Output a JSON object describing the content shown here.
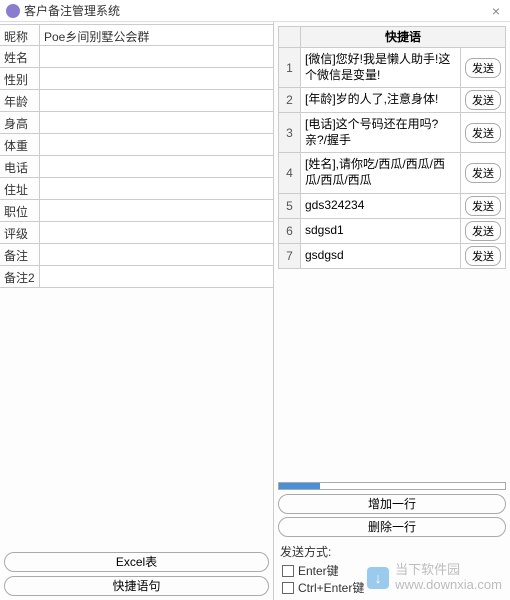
{
  "window": {
    "title": "客户备注管理系统",
    "close": "×"
  },
  "form": {
    "fields": [
      {
        "label": "昵称",
        "value": "Poe乡间别墅公会群"
      },
      {
        "label": "姓名",
        "value": ""
      },
      {
        "label": "性别",
        "value": ""
      },
      {
        "label": "年龄",
        "value": ""
      },
      {
        "label": "身高",
        "value": ""
      },
      {
        "label": "体重",
        "value": ""
      },
      {
        "label": "电话",
        "value": ""
      },
      {
        "label": "住址",
        "value": ""
      },
      {
        "label": "职位",
        "value": ""
      },
      {
        "label": "评级",
        "value": ""
      },
      {
        "label": "备注",
        "value": ""
      },
      {
        "label": "备注2",
        "value": ""
      }
    ]
  },
  "left_buttons": {
    "excel": "Excel表",
    "quick": "快捷语句"
  },
  "phrases": {
    "header": "快捷语",
    "send_label": "发送",
    "rows": [
      {
        "idx": "1",
        "text": "[微信]您好!我是懒人助手!这个微信是变量!"
      },
      {
        "idx": "2",
        "text": "[年龄]岁的人了,注意身体!"
      },
      {
        "idx": "3",
        "text": "[电话]这个号码还在用吗?亲?/握手"
      },
      {
        "idx": "4",
        "text": "[姓名],请你吃/西瓜/西瓜/西瓜/西瓜/西瓜"
      },
      {
        "idx": "5",
        "text": "gds324234"
      },
      {
        "idx": "6",
        "text": "sdgsd1"
      },
      {
        "idx": "7",
        "text": "gsdgsd"
      }
    ]
  },
  "progress": {
    "percent": 18
  },
  "right_buttons": {
    "add": "增加一行",
    "del": "删除一行"
  },
  "send_mode": {
    "title": "发送方式:",
    "opt1": "Enter键",
    "opt2": "Ctrl+Enter键"
  },
  "watermark": {
    "name": "当下软件园",
    "url": "www.downxia.com",
    "badge": "↓"
  }
}
